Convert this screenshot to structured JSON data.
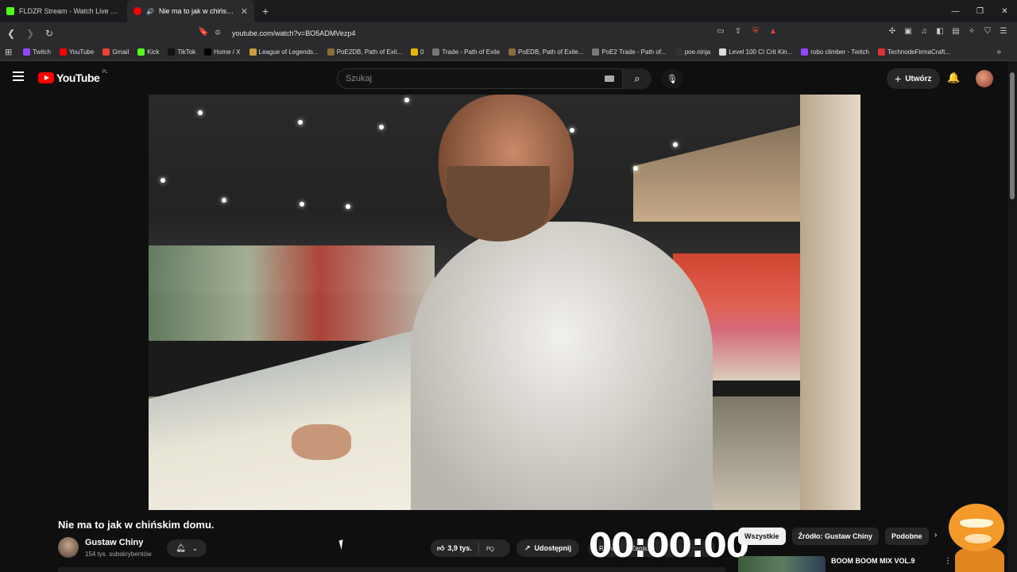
{
  "browser": {
    "tabs": [
      {
        "title": "FLDZR Stream - Watch Live on Kick",
        "color": "#53fc18"
      },
      {
        "title": "Nie ma to jak w chińskim do",
        "color": "#ff0000"
      }
    ],
    "new_tab": "+",
    "url": "youtube.com/watch?v=BO5ADMVezp4",
    "bookmarks": [
      {
        "label": "Twitch",
        "color": "#9146ff"
      },
      {
        "label": "YouTube",
        "color": "#ff0000"
      },
      {
        "label": "Gmail",
        "color": "#ea4335"
      },
      {
        "label": "Kick",
        "color": "#53fc18"
      },
      {
        "label": "TikTok",
        "color": "#111111"
      },
      {
        "label": "Home / X",
        "color": "#000000"
      },
      {
        "label": "League of Legends...",
        "color": "#c8a040"
      },
      {
        "label": "PoE2DB, Path of Exil...",
        "color": "#8a6d3b"
      },
      {
        "label": "0",
        "color": "#e6b800"
      },
      {
        "label": "Trade - Path of Exile",
        "color": "#777777"
      },
      {
        "label": "PoEDB, Path of Exile...",
        "color": "#8a6d3b"
      },
      {
        "label": "PoE2 Trade - Path of...",
        "color": "#777777"
      },
      {
        "label": "poe.ninja",
        "color": "#333333"
      },
      {
        "label": "Level 100 CI Crit Kin...",
        "color": "#dddddd"
      },
      {
        "label": "robo climber - Twitch",
        "color": "#9146ff"
      },
      {
        "label": "TechnodeFirmaCraft...",
        "color": "#d33"
      }
    ]
  },
  "youtube": {
    "logo": "YouTube",
    "country": "PL",
    "search_placeholder": "Szukaj",
    "create_label": "Utwórz",
    "video": {
      "title": "Nie ma to jak w chińskim domu.",
      "channel": "Gustaw Chiny",
      "subscribers": "154 tys. subskrybentów",
      "likes": "3,9 tys.",
      "share": "Udostępnij",
      "more_labels": [
        "Remiks",
        "Zapisz"
      ]
    },
    "overlay_timer": "00:00:00",
    "chips": [
      "Wszystkie",
      "Źródło: Gustaw Chiny",
      "Podobne"
    ],
    "recommendation": {
      "title": "BOOM BOOM MIX VOL.9"
    }
  }
}
